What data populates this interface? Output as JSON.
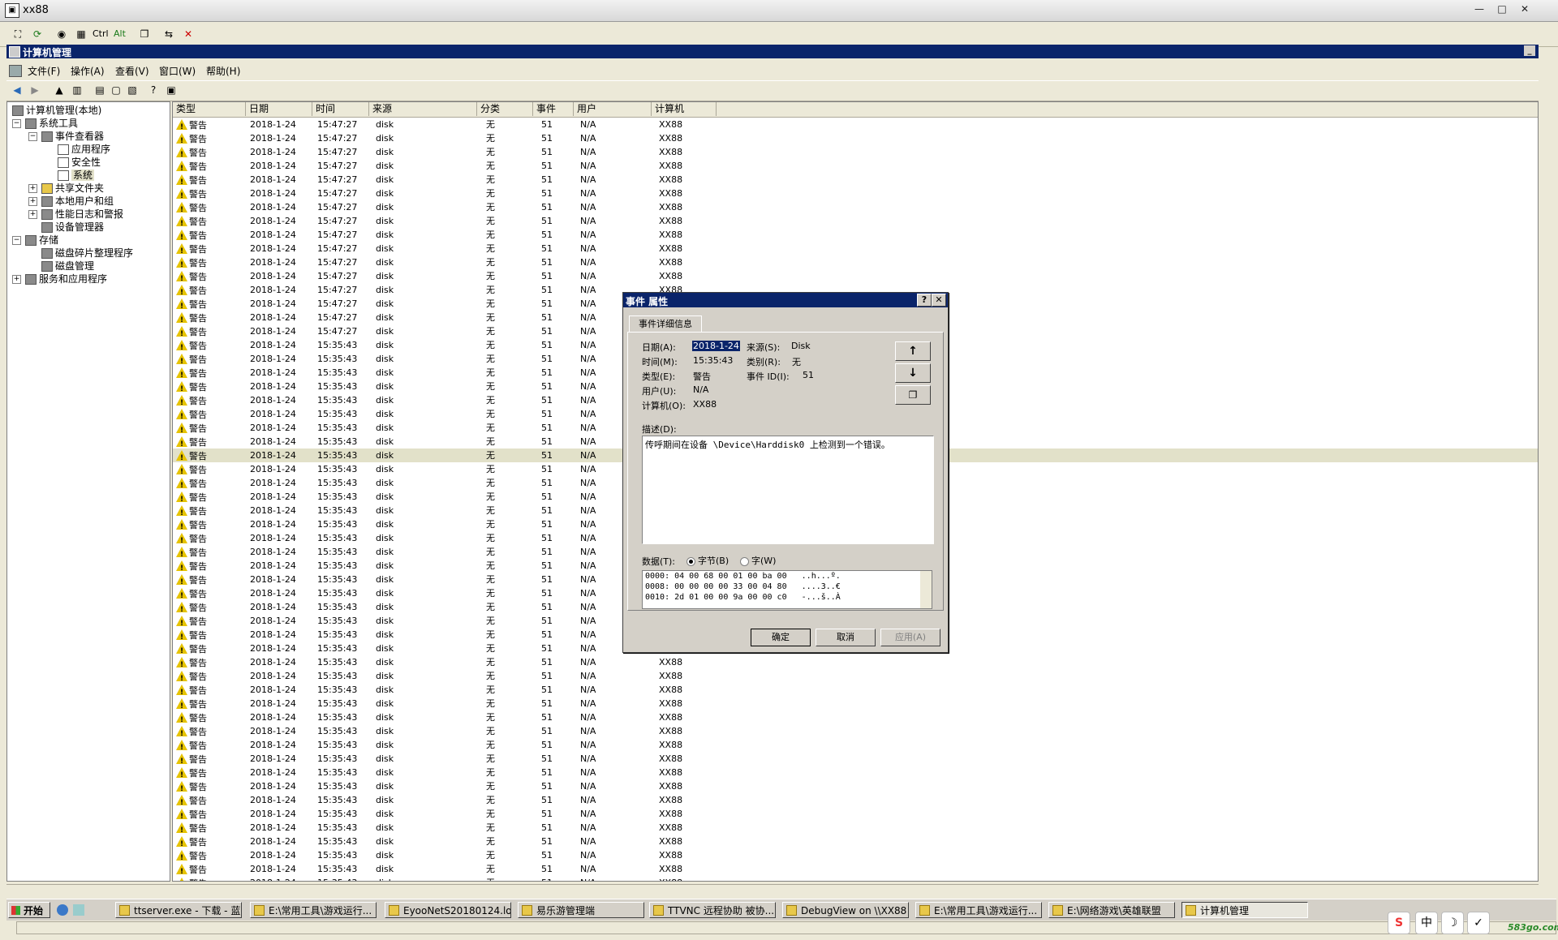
{
  "window": {
    "title": "xx88",
    "min": "—",
    "max": "□",
    "close": "✕"
  },
  "vnc_toolbar": {
    "ctrl": "Ctrl",
    "alt": "Alt"
  },
  "mmc": {
    "title": "计算机管理"
  },
  "menu": [
    "文件(F)",
    "操作(A)",
    "查看(V)",
    "窗口(W)",
    "帮助(H)"
  ],
  "tree": {
    "root": "计算机管理(本地)",
    "system_tools": "系统工具",
    "event_viewer": "事件查看器",
    "application": "应用程序",
    "security": "安全性",
    "system": "系统",
    "shared_folders": "共享文件夹",
    "local_users": "本地用户和组",
    "perf_logs": "性能日志和警报",
    "device_manager": "设备管理器",
    "storage": "存储",
    "defrag": "磁盘碎片整理程序",
    "disk_mgmt": "磁盘管理",
    "services_apps": "服务和应用程序"
  },
  "columns": [
    "类型",
    "日期",
    "时间",
    "来源",
    "分类",
    "事件",
    "用户",
    "计算机"
  ],
  "rows": [
    {
      "type": "警告",
      "date": "2018-1-24",
      "time": "15:47:27",
      "source": "disk",
      "category": "无",
      "event": "51",
      "user": "N/A",
      "computer": "XX88"
    },
    {
      "type": "警告",
      "date": "2018-1-24",
      "time": "15:47:27",
      "source": "disk",
      "category": "无",
      "event": "51",
      "user": "N/A",
      "computer": "XX88"
    },
    {
      "type": "警告",
      "date": "2018-1-24",
      "time": "15:47:27",
      "source": "disk",
      "category": "无",
      "event": "51",
      "user": "N/A",
      "computer": "XX88"
    },
    {
      "type": "警告",
      "date": "2018-1-24",
      "time": "15:47:27",
      "source": "disk",
      "category": "无",
      "event": "51",
      "user": "N/A",
      "computer": "XX88"
    },
    {
      "type": "警告",
      "date": "2018-1-24",
      "time": "15:47:27",
      "source": "disk",
      "category": "无",
      "event": "51",
      "user": "N/A",
      "computer": "XX88"
    },
    {
      "type": "警告",
      "date": "2018-1-24",
      "time": "15:47:27",
      "source": "disk",
      "category": "无",
      "event": "51",
      "user": "N/A",
      "computer": "XX88"
    },
    {
      "type": "警告",
      "date": "2018-1-24",
      "time": "15:47:27",
      "source": "disk",
      "category": "无",
      "event": "51",
      "user": "N/A",
      "computer": "XX88"
    },
    {
      "type": "警告",
      "date": "2018-1-24",
      "time": "15:47:27",
      "source": "disk",
      "category": "无",
      "event": "51",
      "user": "N/A",
      "computer": "XX88"
    },
    {
      "type": "警告",
      "date": "2018-1-24",
      "time": "15:47:27",
      "source": "disk",
      "category": "无",
      "event": "51",
      "user": "N/A",
      "computer": "XX88"
    },
    {
      "type": "警告",
      "date": "2018-1-24",
      "time": "15:47:27",
      "source": "disk",
      "category": "无",
      "event": "51",
      "user": "N/A",
      "computer": "XX88"
    },
    {
      "type": "警告",
      "date": "2018-1-24",
      "time": "15:47:27",
      "source": "disk",
      "category": "无",
      "event": "51",
      "user": "N/A",
      "computer": "XX88"
    },
    {
      "type": "警告",
      "date": "2018-1-24",
      "time": "15:47:27",
      "source": "disk",
      "category": "无",
      "event": "51",
      "user": "N/A",
      "computer": "XX88"
    },
    {
      "type": "警告",
      "date": "2018-1-24",
      "time": "15:47:27",
      "source": "disk",
      "category": "无",
      "event": "51",
      "user": "N/A",
      "computer": "XX88"
    },
    {
      "type": "警告",
      "date": "2018-1-24",
      "time": "15:47:27",
      "source": "disk",
      "category": "无",
      "event": "51",
      "user": "N/A",
      "computer": "XX88"
    },
    {
      "type": "警告",
      "date": "2018-1-24",
      "time": "15:47:27",
      "source": "disk",
      "category": "无",
      "event": "51",
      "user": "N/A",
      "computer": "XX88"
    },
    {
      "type": "警告",
      "date": "2018-1-24",
      "time": "15:47:27",
      "source": "disk",
      "category": "无",
      "event": "51",
      "user": "N/A",
      "computer": "XX88"
    },
    {
      "type": "警告",
      "date": "2018-1-24",
      "time": "15:35:43",
      "source": "disk",
      "category": "无",
      "event": "51",
      "user": "N/A",
      "computer": "XX88"
    },
    {
      "type": "警告",
      "date": "2018-1-24",
      "time": "15:35:43",
      "source": "disk",
      "category": "无",
      "event": "51",
      "user": "N/A",
      "computer": "XX88"
    },
    {
      "type": "警告",
      "date": "2018-1-24",
      "time": "15:35:43",
      "source": "disk",
      "category": "无",
      "event": "51",
      "user": "N/A",
      "computer": "XX88"
    },
    {
      "type": "警告",
      "date": "2018-1-24",
      "time": "15:35:43",
      "source": "disk",
      "category": "无",
      "event": "51",
      "user": "N/A",
      "computer": "XX88"
    },
    {
      "type": "警告",
      "date": "2018-1-24",
      "time": "15:35:43",
      "source": "disk",
      "category": "无",
      "event": "51",
      "user": "N/A",
      "computer": "XX88"
    },
    {
      "type": "警告",
      "date": "2018-1-24",
      "time": "15:35:43",
      "source": "disk",
      "category": "无",
      "event": "51",
      "user": "N/A",
      "computer": "XX88"
    },
    {
      "type": "警告",
      "date": "2018-1-24",
      "time": "15:35:43",
      "source": "disk",
      "category": "无",
      "event": "51",
      "user": "N/A",
      "computer": "XX88"
    },
    {
      "type": "警告",
      "date": "2018-1-24",
      "time": "15:35:43",
      "source": "disk",
      "category": "无",
      "event": "51",
      "user": "N/A",
      "computer": "XX88"
    },
    {
      "type": "警告",
      "date": "2018-1-24",
      "time": "15:35:43",
      "source": "disk",
      "category": "无",
      "event": "51",
      "user": "N/A",
      "computer": "XX88"
    },
    {
      "type": "警告",
      "date": "2018-1-24",
      "time": "15:35:43",
      "source": "disk",
      "category": "无",
      "event": "51",
      "user": "N/A",
      "computer": "XX88"
    },
    {
      "type": "警告",
      "date": "2018-1-24",
      "time": "15:35:43",
      "source": "disk",
      "category": "无",
      "event": "51",
      "user": "N/A",
      "computer": "XX88"
    },
    {
      "type": "警告",
      "date": "2018-1-24",
      "time": "15:35:43",
      "source": "disk",
      "category": "无",
      "event": "51",
      "user": "N/A",
      "computer": "XX88"
    },
    {
      "type": "警告",
      "date": "2018-1-24",
      "time": "15:35:43",
      "source": "disk",
      "category": "无",
      "event": "51",
      "user": "N/A",
      "computer": "XX88"
    },
    {
      "type": "警告",
      "date": "2018-1-24",
      "time": "15:35:43",
      "source": "disk",
      "category": "无",
      "event": "51",
      "user": "N/A",
      "computer": "XX88"
    },
    {
      "type": "警告",
      "date": "2018-1-24",
      "time": "15:35:43",
      "source": "disk",
      "category": "无",
      "event": "51",
      "user": "N/A",
      "computer": "XX88"
    },
    {
      "type": "警告",
      "date": "2018-1-24",
      "time": "15:35:43",
      "source": "disk",
      "category": "无",
      "event": "51",
      "user": "N/A",
      "computer": "XX88"
    },
    {
      "type": "警告",
      "date": "2018-1-24",
      "time": "15:35:43",
      "source": "disk",
      "category": "无",
      "event": "51",
      "user": "N/A",
      "computer": "XX88"
    },
    {
      "type": "警告",
      "date": "2018-1-24",
      "time": "15:35:43",
      "source": "disk",
      "category": "无",
      "event": "51",
      "user": "N/A",
      "computer": "XX88"
    },
    {
      "type": "警告",
      "date": "2018-1-24",
      "time": "15:35:43",
      "source": "disk",
      "category": "无",
      "event": "51",
      "user": "N/A",
      "computer": "XX88"
    },
    {
      "type": "警告",
      "date": "2018-1-24",
      "time": "15:35:43",
      "source": "disk",
      "category": "无",
      "event": "51",
      "user": "N/A",
      "computer": "XX88"
    },
    {
      "type": "警告",
      "date": "2018-1-24",
      "time": "15:35:43",
      "source": "disk",
      "category": "无",
      "event": "51",
      "user": "N/A",
      "computer": "XX88"
    },
    {
      "type": "警告",
      "date": "2018-1-24",
      "time": "15:35:43",
      "source": "disk",
      "category": "无",
      "event": "51",
      "user": "N/A",
      "computer": "XX88"
    },
    {
      "type": "警告",
      "date": "2018-1-24",
      "time": "15:35:43",
      "source": "disk",
      "category": "无",
      "event": "51",
      "user": "N/A",
      "computer": "XX88"
    },
    {
      "type": "警告",
      "date": "2018-1-24",
      "time": "15:35:43",
      "source": "disk",
      "category": "无",
      "event": "51",
      "user": "N/A",
      "computer": "XX88"
    },
    {
      "type": "警告",
      "date": "2018-1-24",
      "time": "15:35:43",
      "source": "disk",
      "category": "无",
      "event": "51",
      "user": "N/A",
      "computer": "XX88"
    },
    {
      "type": "警告",
      "date": "2018-1-24",
      "time": "15:35:43",
      "source": "disk",
      "category": "无",
      "event": "51",
      "user": "N/A",
      "computer": "XX88"
    },
    {
      "type": "警告",
      "date": "2018-1-24",
      "time": "15:35:43",
      "source": "disk",
      "category": "无",
      "event": "51",
      "user": "N/A",
      "computer": "XX88"
    },
    {
      "type": "警告",
      "date": "2018-1-24",
      "time": "15:35:43",
      "source": "disk",
      "category": "无",
      "event": "51",
      "user": "N/A",
      "computer": "XX88"
    },
    {
      "type": "警告",
      "date": "2018-1-24",
      "time": "15:35:43",
      "source": "disk",
      "category": "无",
      "event": "51",
      "user": "N/A",
      "computer": "XX88"
    },
    {
      "type": "警告",
      "date": "2018-1-24",
      "time": "15:35:43",
      "source": "disk",
      "category": "无",
      "event": "51",
      "user": "N/A",
      "computer": "XX88"
    },
    {
      "type": "警告",
      "date": "2018-1-24",
      "time": "15:35:43",
      "source": "disk",
      "category": "无",
      "event": "51",
      "user": "N/A",
      "computer": "XX88"
    },
    {
      "type": "警告",
      "date": "2018-1-24",
      "time": "15:35:43",
      "source": "disk",
      "category": "无",
      "event": "51",
      "user": "N/A",
      "computer": "XX88"
    },
    {
      "type": "警告",
      "date": "2018-1-24",
      "time": "15:35:43",
      "source": "disk",
      "category": "无",
      "event": "51",
      "user": "N/A",
      "computer": "XX88"
    },
    {
      "type": "警告",
      "date": "2018-1-24",
      "time": "15:35:43",
      "source": "disk",
      "category": "无",
      "event": "51",
      "user": "N/A",
      "computer": "XX88"
    },
    {
      "type": "警告",
      "date": "2018-1-24",
      "time": "15:35:43",
      "source": "disk",
      "category": "无",
      "event": "51",
      "user": "N/A",
      "computer": "XX88"
    },
    {
      "type": "警告",
      "date": "2018-1-24",
      "time": "15:35:43",
      "source": "disk",
      "category": "无",
      "event": "51",
      "user": "N/A",
      "computer": "XX88"
    },
    {
      "type": "警告",
      "date": "2018-1-24",
      "time": "15:35:43",
      "source": "disk",
      "category": "无",
      "event": "51",
      "user": "N/A",
      "computer": "XX88"
    },
    {
      "type": "警告",
      "date": "2018-1-24",
      "time": "15:35:43",
      "source": "disk",
      "category": "无",
      "event": "51",
      "user": "N/A",
      "computer": "XX88"
    },
    {
      "type": "警告",
      "date": "2018-1-24",
      "time": "15:35:43",
      "source": "disk",
      "category": "无",
      "event": "51",
      "user": "N/A",
      "computer": "XX88"
    },
    {
      "type": "警告",
      "date": "2018-1-24",
      "time": "15:35:43",
      "source": "disk",
      "category": "无",
      "event": "51",
      "user": "N/A",
      "computer": "XX88"
    }
  ],
  "selected_row": 24,
  "dialog": {
    "title": "事件 属性",
    "help": "?",
    "close": "✕",
    "tab": "事件详细信息",
    "date_label": "日期(A):",
    "date_value": "2018-1-24",
    "source_label": "来源(S):",
    "source_value": "Disk",
    "time_label": "时间(M):",
    "time_value": "15:35:43",
    "category_label": "类别(R):",
    "category_value": "无",
    "type_label": "类型(E):",
    "type_value": "警告",
    "eventid_label": "事件 ID(I):",
    "eventid_value": "51",
    "user_label": "用户(U):",
    "user_value": "N/A",
    "computer_label": "计算机(O):",
    "computer_value": "XX88",
    "desc_label": "描述(D):",
    "desc_text": "传呼期间在设备 \\Device\\Harddisk0 上检测到一个错误。",
    "data_label": "数据(T):",
    "radio_bytes": "字节(B)",
    "radio_words": "字(W)",
    "hex": [
      "0000: 04 00 68 00 01 00 ba 00   ..h...º.",
      "0008: 00 00 00 00 33 00 04 80   ....3..€",
      "0010: 2d 01 00 00 9a 00 00 c0   -...š..À"
    ],
    "ok": "确定",
    "cancel": "取消",
    "apply": "应用(A)"
  },
  "taskbar": {
    "start": "开始",
    "tasks": [
      "ttserver.exe - 下载 - 蓝...",
      "E:\\常用工具\\游戏运行...",
      "EyooNetS20180124.log -...",
      "易乐游管理端",
      "TTVNC 远程协助  被协...",
      "DebugView on \\\\XX88 (lo...",
      "E:\\常用工具\\游戏运行...",
      "E:\\网络游戏\\英雄联盟",
      "计算机管理"
    ]
  },
  "ime": {
    "s": "S",
    "zh": "中",
    "moon": "☽",
    "hook": "✓"
  },
  "watermark": "583go.com"
}
